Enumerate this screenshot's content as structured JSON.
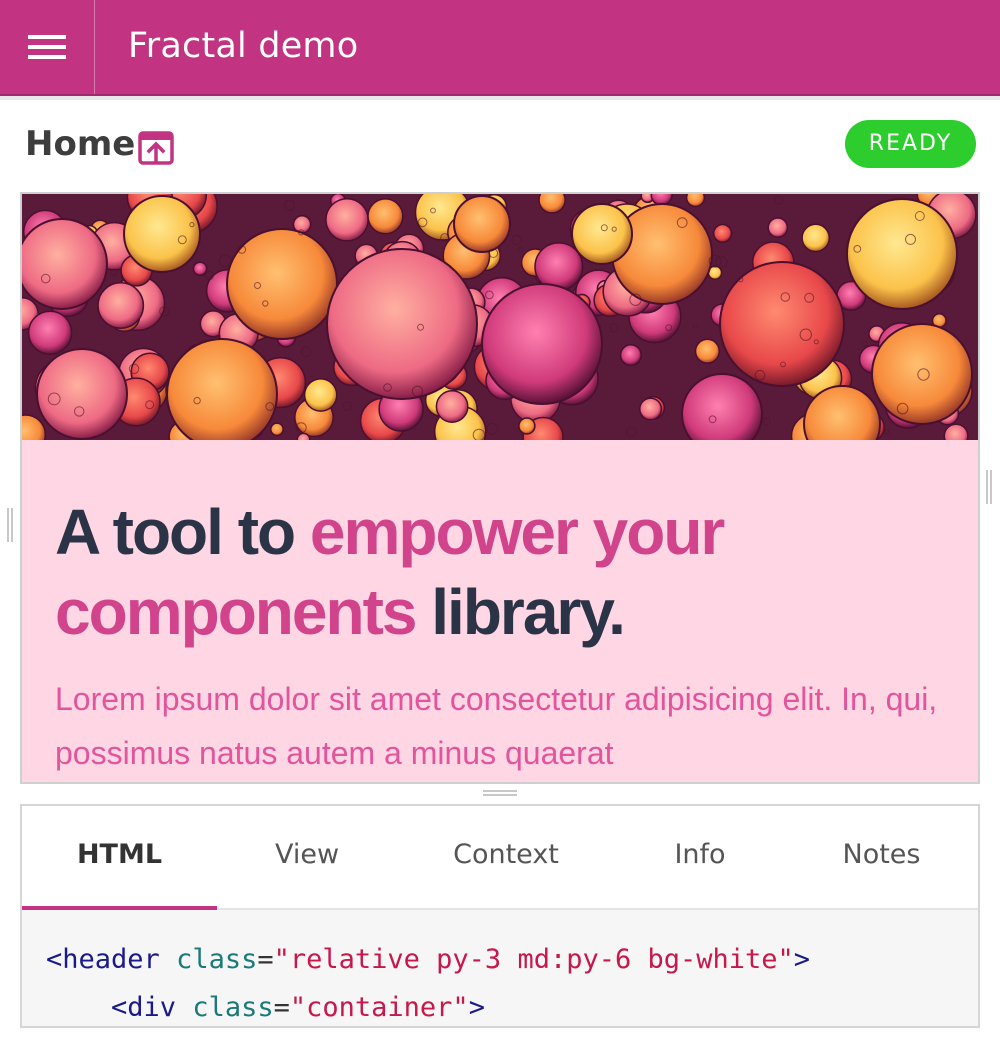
{
  "header": {
    "menu_icon": "hamburger-icon",
    "title": "Fractal demo",
    "brand_color": "#c23381"
  },
  "component": {
    "title": "Home",
    "open_icon": "open-external-icon",
    "status": "READY",
    "status_color": "#2ccd2c"
  },
  "preview": {
    "image_description_icon": "bubbles-hero-image",
    "headline_part1": "A tool to ",
    "headline_highlight": "empower your components",
    "headline_part2": " library.",
    "body": "Lorem ipsum dolor sit amet consectetur adipisicing elit. In, qui, possimus natus autem a minus quaerat",
    "bg_color": "#ffd6e4",
    "accent_color": "#d1448c"
  },
  "panel": {
    "tabs": [
      {
        "label": "HTML",
        "active": true
      },
      {
        "label": "View",
        "active": false
      },
      {
        "label": "Context",
        "active": false
      },
      {
        "label": "Info",
        "active": false
      },
      {
        "label": "Notes",
        "active": false
      }
    ],
    "code": {
      "line1": {
        "tag_open": "<header",
        "attr": "class",
        "eq": "=",
        "value": "\"relative py-3 md:py-6 bg-white\"",
        "tag_close": ">"
      },
      "line2": {
        "indent": "    ",
        "tag_open": "<div",
        "attr": "class",
        "eq": "=",
        "value": "\"container\"",
        "tag_close": ">"
      }
    }
  }
}
